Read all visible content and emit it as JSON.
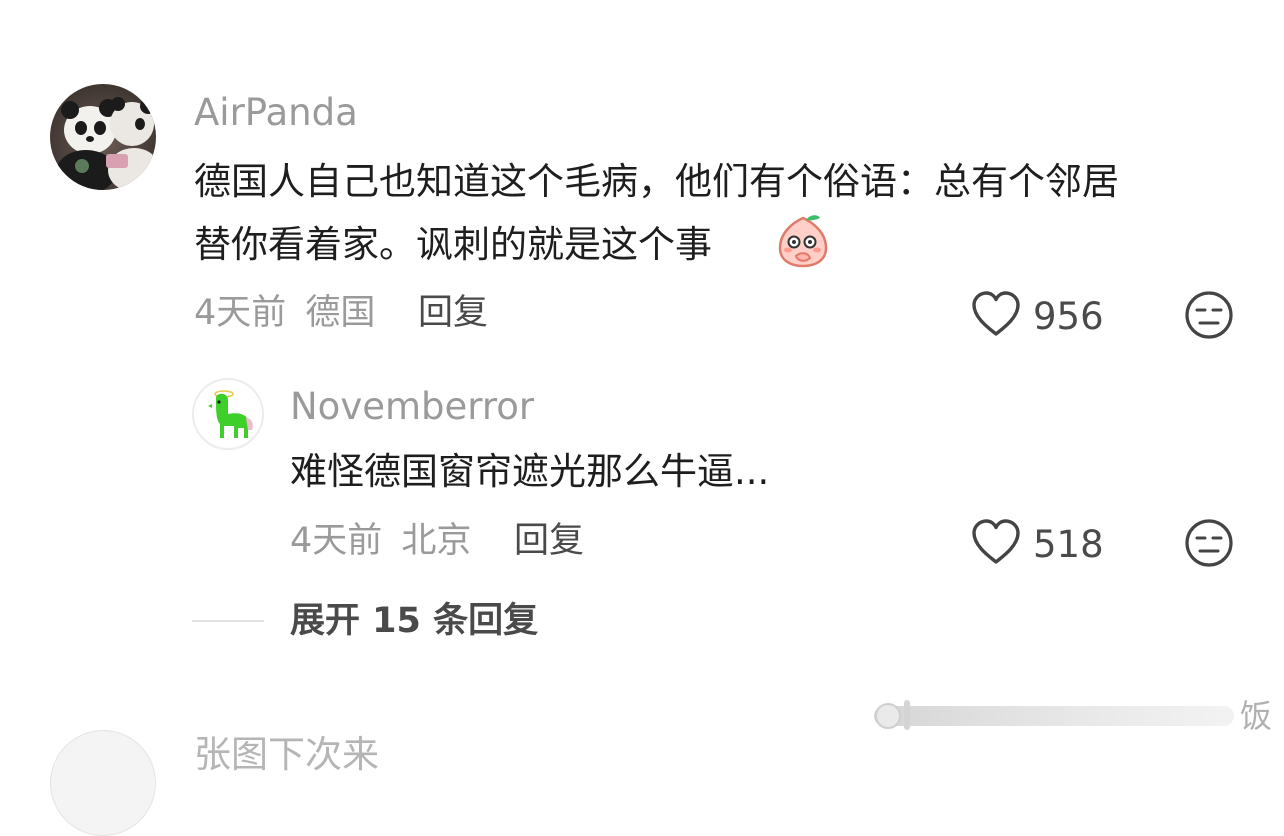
{
  "comments": [
    {
      "username": "AirPanda",
      "text_line1": "德国人自己也知道这个毛病，他们有个俗语：总有个邻居",
      "text_line2": "替你看着家。讽刺的就是这个事",
      "time": "4天前",
      "location": "德国",
      "reply_label": "回复",
      "likes": "956",
      "emoji": "peach-cover-mouth-emoji",
      "avatar": "panda-plush-avatar"
    }
  ],
  "replies": [
    {
      "username": "Novemberror",
      "text": "难怪德国窗帘遮光那么牛逼...",
      "time": "4天前",
      "location": "北京",
      "reply_label": "回复",
      "likes": "518",
      "avatar": "green-alpaca-avatar"
    }
  ],
  "expand": {
    "label": "展开 15 条回复"
  },
  "next_comment": {
    "username_partial": "张图下次来"
  },
  "watermark": {
    "text": "饭"
  },
  "icons": {
    "like": "heart-outline-icon",
    "reaction": "neutral-face-icon"
  },
  "colors": {
    "muted_text": "#9a9a9a",
    "body_text": "#1e1e1e",
    "action_text": "#4a4a4a"
  }
}
